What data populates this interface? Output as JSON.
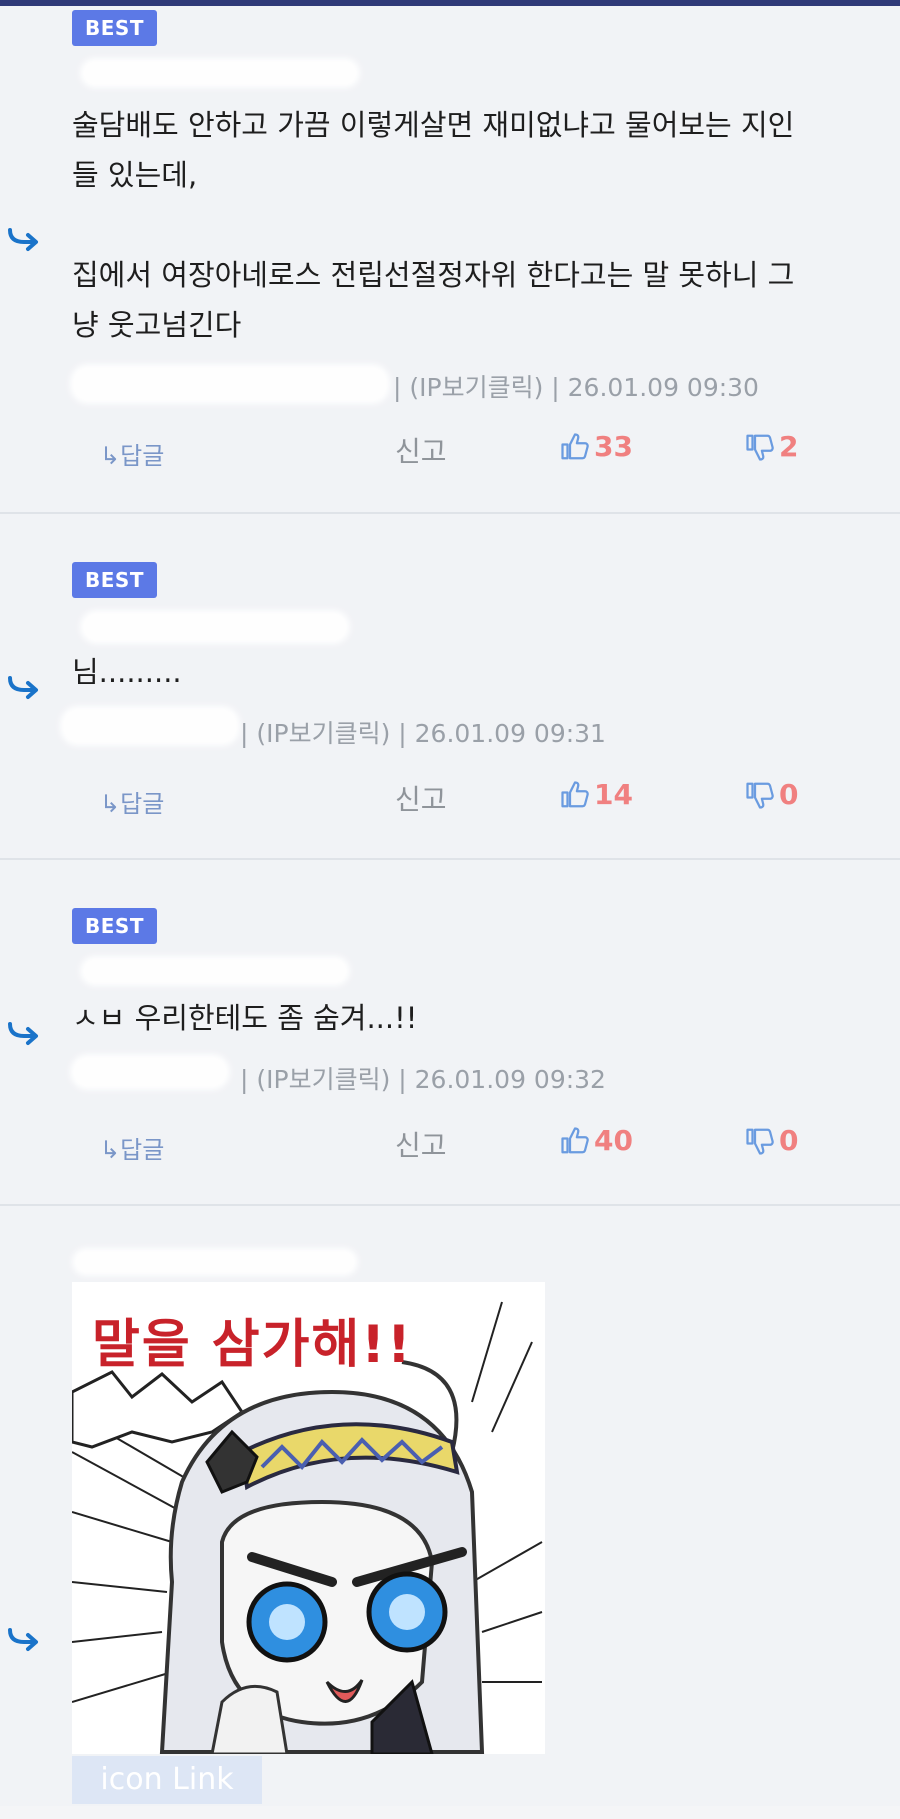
{
  "comments": [
    {
      "badge": "BEST",
      "text": "술담배도 안하고 가끔 이렇게살면 재미없냐고 물어보는 지인\n들 있는데,\n\n집에서 여장아네로스 전립선절정자위 한다고는 말 못하니 그\n냥 웃고넘긴다",
      "meta": "| (IP보기클릭) | 26.01.09 09:30",
      "reply_label": "↳답글",
      "report_label": "신고",
      "likes": "33",
      "dislikes": "2"
    },
    {
      "badge": "BEST",
      "text": "님.........",
      "meta": "| (IP보기클릭) | 26.01.09 09:31",
      "reply_label": "↳답글",
      "report_label": "신고",
      "likes": "14",
      "dislikes": "0"
    },
    {
      "badge": "BEST",
      "text": "ㅅㅂ 우리한테도 좀 숨겨...!!",
      "meta": "| (IP보기클릭) | 26.01.09 09:32",
      "reply_label": "↳답글",
      "report_label": "신고",
      "likes": "40",
      "dislikes": "0"
    }
  ],
  "sticker": {
    "caption": "말을 삼가해!!",
    "link_label": "icon Link"
  },
  "colors": {
    "badge": "#5c79e6",
    "arrow": "#1a73c9",
    "count": "#f08080",
    "thumb": "#6a9be0",
    "top_bar": "#2f3a78"
  },
  "icons": [
    "reply-arrow-icon",
    "thumbs-up-icon",
    "thumbs-down-icon"
  ]
}
